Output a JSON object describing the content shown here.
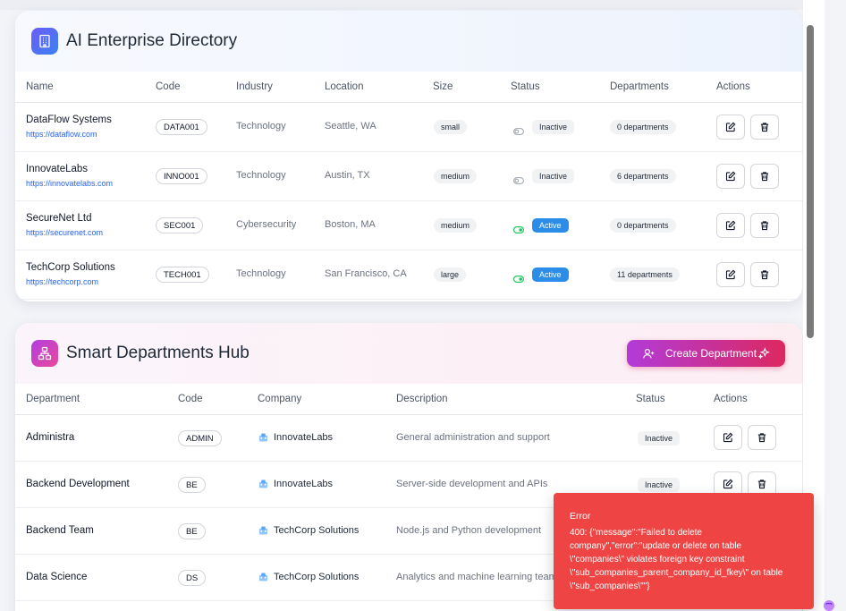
{
  "enterprise": {
    "title": "AI Enterprise Directory",
    "icon": "building-icon",
    "columns": [
      "Name",
      "Code",
      "Industry",
      "Location",
      "Size",
      "Status",
      "Departments",
      "Actions"
    ],
    "rows": [
      {
        "name": "DataFlow Systems",
        "url": "https://dataflow.com",
        "code": "DATA001",
        "industry": "Technology",
        "location": "Seattle, WA",
        "size": "small",
        "active": false,
        "status": "Inactive",
        "departments": "0 departments"
      },
      {
        "name": "InnovateLabs",
        "url": "https://innovatelabs.com",
        "code": "INNO001",
        "industry": "Technology",
        "location": "Austin, TX",
        "size": "medium",
        "active": false,
        "status": "Inactive",
        "departments": "6 departments"
      },
      {
        "name": "SecureNet Ltd",
        "url": "https://securenet.com",
        "code": "SEC001",
        "industry": "Cybersecurity",
        "location": "Boston, MA",
        "size": "medium",
        "active": true,
        "status": "Active",
        "departments": "0 departments"
      },
      {
        "name": "TechCorp Solutions",
        "url": "https://techcorp.com",
        "code": "TECH001",
        "industry": "Technology",
        "location": "San Francisco, CA",
        "size": "large",
        "active": true,
        "status": "Active",
        "departments": "11 departments"
      }
    ]
  },
  "departments": {
    "title": "Smart Departments Hub",
    "icon": "org-chart-icon",
    "create_label": "Create Department",
    "columns": [
      "Department",
      "Code",
      "Company",
      "Description",
      "Status",
      "Actions"
    ],
    "rows": [
      {
        "name": "Administra",
        "code": "ADMIN",
        "company": "InnovateLabs",
        "description": "General administration and support",
        "status": "Inactive"
      },
      {
        "name": "Backend Development",
        "code": "BE",
        "company": "InnovateLabs",
        "description": "Server-side development and APIs",
        "status": "Inactive"
      },
      {
        "name": "Backend Team",
        "code": "BE",
        "company": "TechCorp Solutions",
        "description": "Node.js and Python development",
        "status": ""
      },
      {
        "name": "Data Science",
        "code": "DS",
        "company": "TechCorp Solutions",
        "description": "Analytics and machine learning team",
        "status": ""
      }
    ]
  },
  "toast": {
    "title": "Error",
    "message": "400: {\"message\":\"Failed to delete company\",\"error\":\"update or delete on table \\\"companies\\\" violates foreign key constraint \\\"sub_companies_parent_company_id_fkey\\\" on table \\\"sub_companies\\\"\"}"
  },
  "colors": {
    "accent_blue": "#2b8de8",
    "error_red": "#ef4444",
    "link_blue": "#2563eb",
    "toggle_on": "#22c55e"
  }
}
